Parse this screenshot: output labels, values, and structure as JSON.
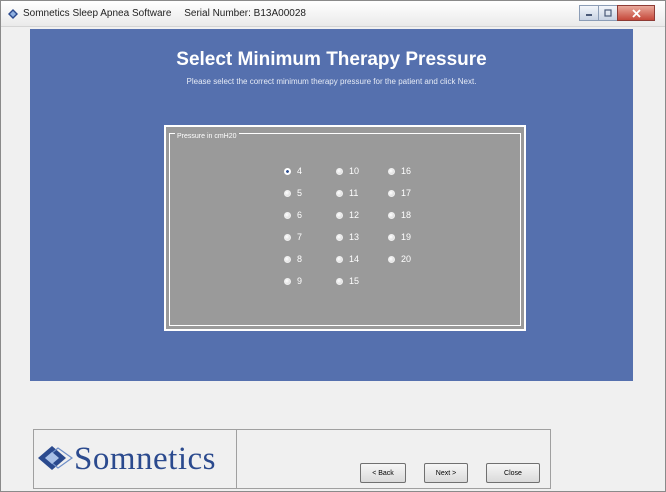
{
  "window": {
    "app_name": "Somnetics Sleep Apnea Software",
    "serial_label": "Serial Number: B13A00028"
  },
  "colors": {
    "panel": "#5570ae",
    "group": "#9a9a9a",
    "brand": "#2b4a8e"
  },
  "page": {
    "title": "Select Minimum Therapy Pressure",
    "instruction": "Please select the correct minimum therapy pressure for the patient and click Next."
  },
  "pressure_group": {
    "legend": "Pressure in cmH20",
    "selected": "4",
    "options": [
      "4",
      "5",
      "6",
      "7",
      "8",
      "9",
      "10",
      "11",
      "12",
      "13",
      "14",
      "15",
      "16",
      "17",
      "18",
      "19",
      "20"
    ]
  },
  "footer": {
    "logo_text": "Somnetics",
    "back_label": "< Back",
    "next_label": "Next >",
    "close_label": "Close"
  }
}
